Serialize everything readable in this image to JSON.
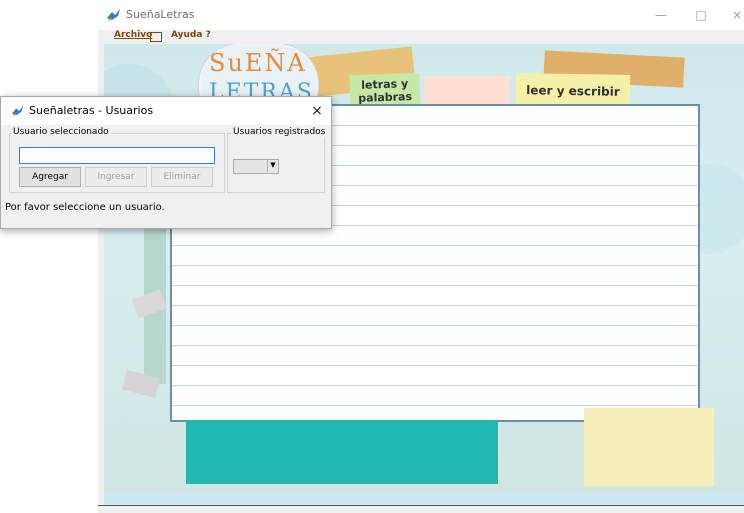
{
  "main_window": {
    "title": "SueñaLetras",
    "controls": {
      "minimize": "—",
      "maximize": "□",
      "close": "×"
    }
  },
  "menu": {
    "archivo": "Archivo",
    "ayuda": "Ayuda ?"
  },
  "logo": {
    "line1": "SuEÑA",
    "line2": "LETRAS"
  },
  "tabs": {
    "letras_y_palabras": "letras y palabras",
    "leer_y_escribir": "leer y escribir"
  },
  "dialog": {
    "title": "Sueñaletras - Usuarios",
    "close": "×",
    "group_usuario": "Usuario seleccionado",
    "usuario_value": "",
    "buttons": {
      "agregar": "Agregar",
      "ingresar": "Ingresar",
      "eliminar": "Eliminar"
    },
    "group_registrados": "Usuarios registrados",
    "select_value": "",
    "status": "Por favor seleccione un usuario."
  },
  "colors": {
    "teal_box": "#20b8b0",
    "tab_green": "#c6e8a7",
    "tab_yellow": "#f4f0a8",
    "tab_pink": "#fde0d2"
  }
}
